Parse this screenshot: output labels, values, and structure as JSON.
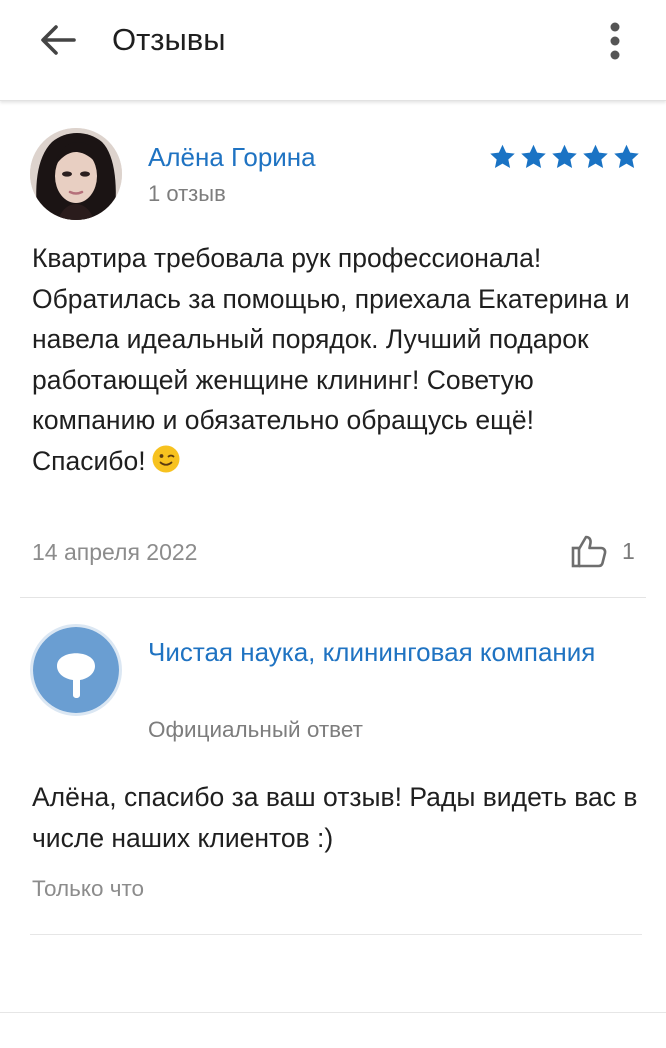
{
  "app_bar": {
    "back_icon": "arrow-left-icon",
    "title": "Отзывы",
    "menu_icon": "more-vertical-icon"
  },
  "review": {
    "author": "Алёна Горина",
    "reviews_count": "1 отзыв",
    "rating": 5,
    "rating_max": 5,
    "text": "Квартира требовала рук профессионала! Обратилась за помощью, приехала Екатерина и навела идеальный порядок. Лучший подарок работающей женщине клининг! Советую компанию и обязательно обращусь ещё! Спасибо!",
    "emoji": "winking-face-icon",
    "date": "14 апреля 2022",
    "likes": "1"
  },
  "reply": {
    "company": "Чистая наука, клининговая компания",
    "label": "Официальный ответ",
    "text": "Алёна, спасибо за ваш отзыв! Рады видеть вас в числе наших клиентов :)",
    "time": "Только что"
  },
  "colors": {
    "accent": "#1f73c2",
    "star": "#1a73c4",
    "muted": "#7d7d7d",
    "company_logo": "#6a9ed2",
    "emoji": "#f7c21f"
  }
}
